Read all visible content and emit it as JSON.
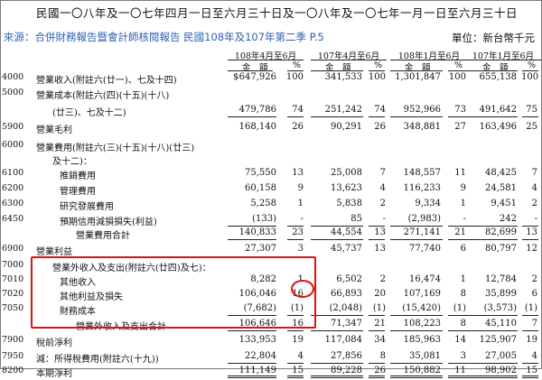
{
  "header": {
    "period_title": "民國一〇八年及一〇七年四月一日至六月三十日及一〇八年及一〇七年一月一日至六月三十日",
    "source": "來源：合併財務報告暨會計師核閱報告 民國108年及107年第二季 P.5",
    "unit": "單位：新台幣千元"
  },
  "columns": [
    {
      "period": "108年4月至6月",
      "amount_label": "金　額",
      "pct_label": "%"
    },
    {
      "period": "107年4月至6月",
      "amount_label": "金　額",
      "pct_label": "%"
    },
    {
      "period": "108年1月至6月",
      "amount_label": "金　額",
      "pct_label": "%"
    },
    {
      "period": "107年1月至6月",
      "amount_label": "金　額",
      "pct_label": "%"
    }
  ],
  "currency_symbol": "$",
  "rows": [
    {
      "code": "4000",
      "label": "營業收入(附註六(廿一)、七及十四)",
      "v": [
        "647,926",
        "100",
        "341,533",
        "100",
        "1,301,847",
        "100",
        "655,138",
        "100"
      ]
    },
    {
      "code": "5000",
      "label": "營業成本(附註六(四)(十五)(十八)",
      "v": [
        "",
        "",
        "",
        "",
        "",
        "",
        "",
        ""
      ]
    },
    {
      "code": "",
      "label": "(廿三)、七及十二)",
      "v": [
        "479,786",
        "74",
        "251,242",
        "74",
        "952,966",
        "73",
        "491,642",
        "75"
      ]
    },
    {
      "code": "5900",
      "label": "營業毛利",
      "v": [
        "168,140",
        "26",
        "90,291",
        "26",
        "348,881",
        "27",
        "163,496",
        "25"
      ]
    },
    {
      "code": "6000",
      "label": "營業費用(附註六(三)(十五)(十八)(廿三)",
      "v": [
        "",
        "",
        "",
        "",
        "",
        "",
        "",
        ""
      ]
    },
    {
      "code": "",
      "label": "及十二)：",
      "v": [
        "",
        "",
        "",
        "",
        "",
        "",
        "",
        ""
      ]
    },
    {
      "code": "6100",
      "label": "推銷費用",
      "v": [
        "75,550",
        "13",
        "25,008",
        "7",
        "148,557",
        "11",
        "48,425",
        "7"
      ]
    },
    {
      "code": "6200",
      "label": "管理費用",
      "v": [
        "60,158",
        "9",
        "13,623",
        "4",
        "116,233",
        "9",
        "24,581",
        "4"
      ]
    },
    {
      "code": "6300",
      "label": "研究發展費用",
      "v": [
        "5,258",
        "1",
        "5,838",
        "2",
        "9,334",
        "1",
        "9,451",
        "2"
      ]
    },
    {
      "code": "6450",
      "label": "預期信用減損損失(利益)",
      "v": [
        "(133)",
        "-",
        "85",
        "-",
        "(2,983)",
        "-",
        "242",
        "-"
      ]
    },
    {
      "code": "",
      "label": "營業費用合計",
      "v": [
        "140,833",
        "23",
        "44,554",
        "13",
        "271,141",
        "21",
        "82,699",
        "13"
      ]
    },
    {
      "code": "6900",
      "label": "營業利益",
      "v": [
        "27,307",
        "3",
        "45,737",
        "13",
        "77,740",
        "6",
        "80,797",
        "12"
      ]
    },
    {
      "code": "7000",
      "label": "營業外收入及支出(附註六(廿四)及七)：",
      "v": [
        "",
        "",
        "",
        "",
        "",
        "",
        "",
        ""
      ]
    },
    {
      "code": "7010",
      "label": "其他收入",
      "v": [
        "8,282",
        "1",
        "6,502",
        "2",
        "16,474",
        "1",
        "12,784",
        "2"
      ]
    },
    {
      "code": "7020",
      "label": "其他利益及損失",
      "v": [
        "106,046",
        "16",
        "66,893",
        "20",
        "107,169",
        "8",
        "35,899",
        "6"
      ]
    },
    {
      "code": "7050",
      "label": "財務成本",
      "v": [
        "(7,682)",
        "(1)",
        "(2,048)",
        "(1)",
        "(15,420)",
        "(1)",
        "(3,573)",
        "(1)"
      ]
    },
    {
      "code": "",
      "label": "營業外收入及支出合計",
      "v": [
        "106,646",
        "16",
        "71,347",
        "21",
        "108,223",
        "8",
        "45,110",
        "7"
      ]
    },
    {
      "code": "7900",
      "label": "稅前淨利",
      "v": [
        "133,953",
        "19",
        "117,084",
        "34",
        "185,963",
        "14",
        "125,907",
        "19"
      ]
    },
    {
      "code": "7950",
      "label": "減：所得稅費用(附註六(十九))",
      "v": [
        "22,804",
        "4",
        "27,856",
        "8",
        "35,081",
        "3",
        "27,005",
        "4"
      ]
    },
    {
      "code": "8200",
      "label": "本期淨利",
      "v": [
        "111,149",
        "15",
        "89,228",
        "26",
        "150,882",
        "11",
        "98,902",
        "15"
      ]
    }
  ]
}
